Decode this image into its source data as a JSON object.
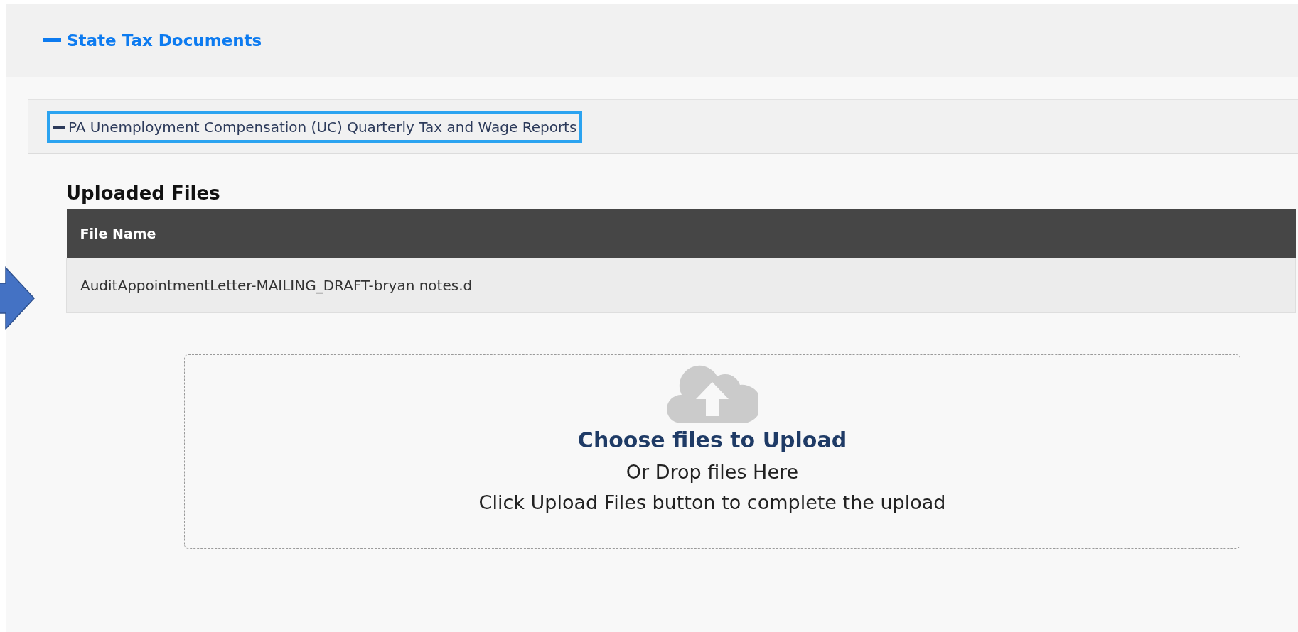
{
  "section": {
    "title": "State Tax Documents",
    "expanded": true
  },
  "subsection": {
    "title": "PA Unemployment Compensation (UC) Quarterly Tax and Wage Reports",
    "expanded": true,
    "focused": true
  },
  "uploaded_files": {
    "heading": "Uploaded Files",
    "columns": [
      "File Name"
    ],
    "rows": [
      [
        "AuditAppointmentLetter-MAILING_DRAFT-bryan notes.d"
      ]
    ]
  },
  "dropzone": {
    "title": "Choose files to Upload",
    "subtitle": "Or Drop files Here",
    "hint": "Click Upload Files button to complete the upload"
  }
}
